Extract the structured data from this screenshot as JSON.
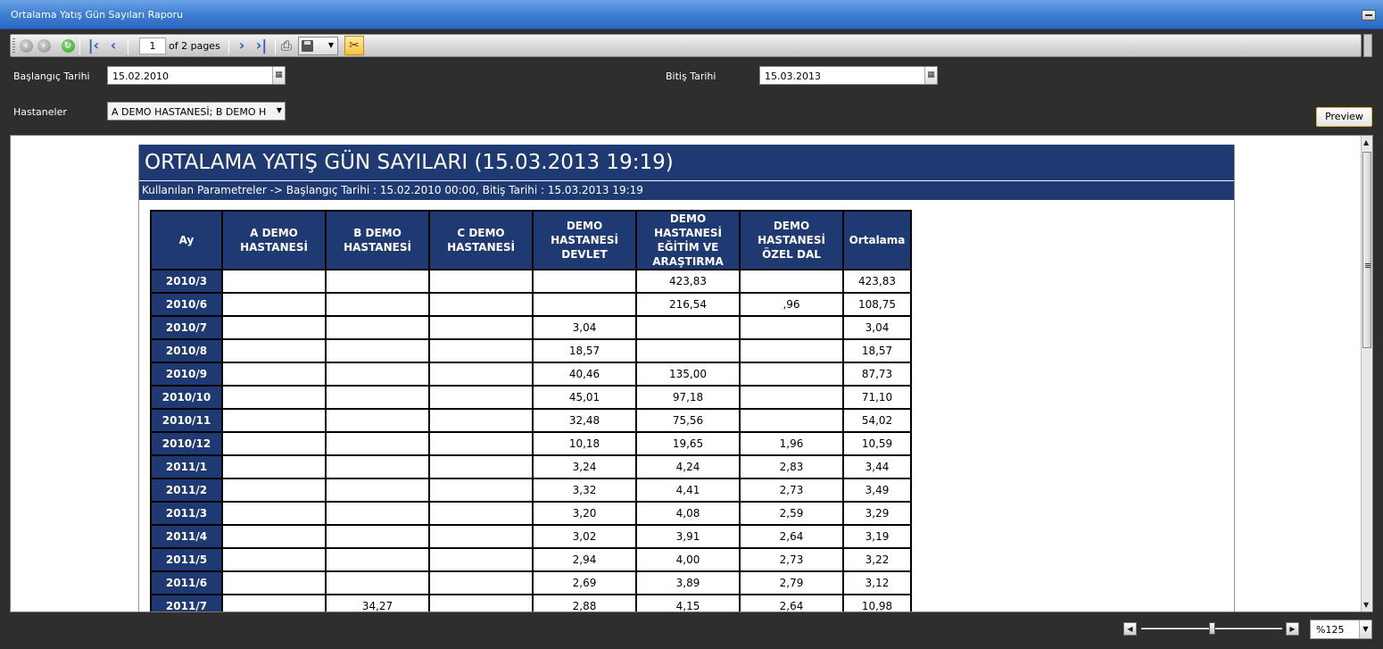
{
  "window": {
    "title": "Ortalama Yatış Gün Sayıları Raporu"
  },
  "toolbar": {
    "page_current": "1",
    "page_total_text": "of 2 pages"
  },
  "params": {
    "start_label": "Başlangıç Tarihi",
    "start_value": "15.02.2010",
    "end_label": "Bitiş Tarihi",
    "end_value": "15.03.2013",
    "hospitals_label": "Hastaneler",
    "hospitals_value": "A DEMO HASTANESİ; B DEMO H",
    "preview_label": "Preview"
  },
  "report": {
    "title": "ORTALAMA YATIŞ GÜN SAYILARI (15.03.2013 19:19)",
    "subtitle": "Kullanılan Parametreler -> Başlangıç Tarihi : 15.02.2010 00:00, Bitiş Tarihi : 15.03.2013 19:19",
    "columns": [
      "Ay",
      "A DEMO\nHASTANESİ",
      "B DEMO\nHASTANESİ",
      "C DEMO\nHASTANESİ",
      "DEMO\nHASTANESİ\nDEVLET",
      "DEMO\nHASTANESİ\nEĞİTİM VE\nARAŞTIRMA",
      "DEMO\nHASTANESİ\nÖZEL DAL",
      "Ortalama"
    ],
    "rows": [
      [
        "2010/3",
        "",
        "",
        "",
        "",
        "423,83",
        "",
        "423,83"
      ],
      [
        "2010/6",
        "",
        "",
        "",
        "",
        "216,54",
        ",96",
        "108,75"
      ],
      [
        "2010/7",
        "",
        "",
        "",
        "3,04",
        "",
        "",
        "3,04"
      ],
      [
        "2010/8",
        "",
        "",
        "",
        "18,57",
        "",
        "",
        "18,57"
      ],
      [
        "2010/9",
        "",
        "",
        "",
        "40,46",
        "135,00",
        "",
        "87,73"
      ],
      [
        "2010/10",
        "",
        "",
        "",
        "45,01",
        "97,18",
        "",
        "71,10"
      ],
      [
        "2010/11",
        "",
        "",
        "",
        "32,48",
        "75,56",
        "",
        "54,02"
      ],
      [
        "2010/12",
        "",
        "",
        "",
        "10,18",
        "19,65",
        "1,96",
        "10,59"
      ],
      [
        "2011/1",
        "",
        "",
        "",
        "3,24",
        "4,24",
        "2,83",
        "3,44"
      ],
      [
        "2011/2",
        "",
        "",
        "",
        "3,32",
        "4,41",
        "2,73",
        "3,49"
      ],
      [
        "2011/3",
        "",
        "",
        "",
        "3,20",
        "4,08",
        "2,59",
        "3,29"
      ],
      [
        "2011/4",
        "",
        "",
        "",
        "3,02",
        "3,91",
        "2,64",
        "3,19"
      ],
      [
        "2011/5",
        "",
        "",
        "",
        "2,94",
        "4,00",
        "2,73",
        "3,22"
      ],
      [
        "2011/6",
        "",
        "",
        "",
        "2,69",
        "3,89",
        "2,79",
        "3,12"
      ],
      [
        "2011/7",
        "",
        "34,27",
        "",
        "2,88",
        "4,15",
        "2,64",
        "10,98"
      ]
    ]
  },
  "zoom": {
    "value": "%125",
    "level_fraction": 0.5
  }
}
